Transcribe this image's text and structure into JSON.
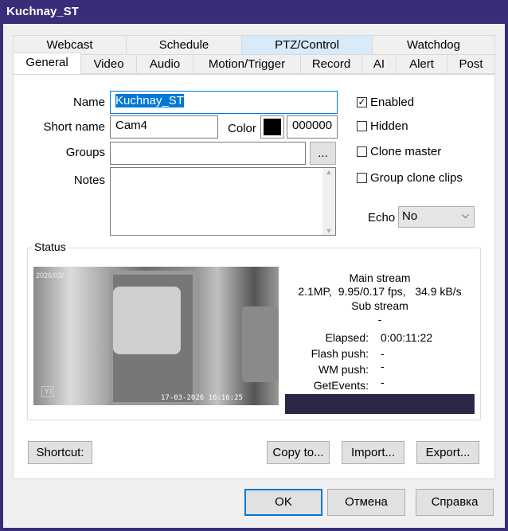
{
  "window": {
    "title": "Kuchnay_ST"
  },
  "tabs_row1": [
    "Webcast",
    "Schedule",
    "PTZ/Control",
    "Watchdog"
  ],
  "tabs_row2": [
    "General",
    "Video",
    "Audio",
    "Motion/Trigger",
    "Record",
    "AI",
    "Alert",
    "Post"
  ],
  "form": {
    "name_label": "Name",
    "name_value": "Kuchnay_ST",
    "short_label": "Short name",
    "short_value": "Cam4",
    "color_label": "Color",
    "color_value": "000000",
    "color_swatch": "#000000",
    "groups_label": "Groups",
    "groups_value": "",
    "groups_button": "...",
    "notes_label": "Notes",
    "notes_value": ""
  },
  "options": {
    "enabled": "Enabled",
    "hidden": "Hidden",
    "clone_master": "Clone master",
    "group_clone": "Group clone clips",
    "echo_label": "Echo",
    "echo_value": "No"
  },
  "status": {
    "title": "Status",
    "main_stream": "Main stream",
    "main_info": "2.1MP,  9.95/0.17 fps,   34.9 kB/s",
    "sub_stream": "Sub stream",
    "sub_info": "-",
    "elapsed_label": "Elapsed:",
    "elapsed_value": "0:00:11:22",
    "flash_label": "Flash push:",
    "flash_value": "-",
    "wm_label": "WM push:",
    "wm_value": "-",
    "events_label": "GetEvents:",
    "events_value": "-",
    "preview_date": "2026/03/",
    "preview_timestamp": "17-03-2026 16:16:25",
    "preview_logo": "YI"
  },
  "buttons": {
    "shortcut": "Shortcut:",
    "copy": "Copy to...",
    "import": "Import...",
    "export": "Export...",
    "ok": "OK",
    "cancel": "Отмена",
    "help": "Справка"
  }
}
